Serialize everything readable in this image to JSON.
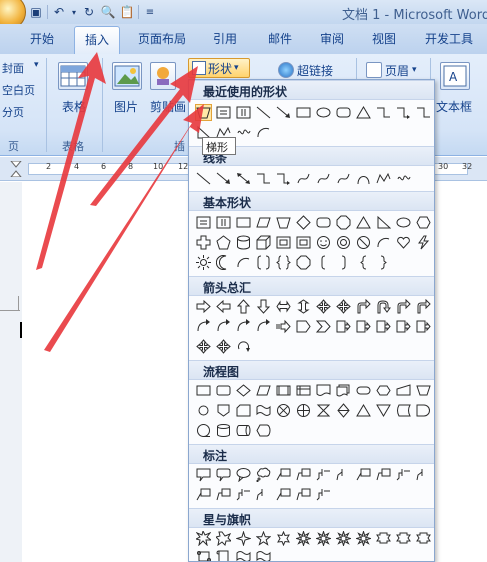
{
  "app": {
    "doc_title": "文档 1 - Microsoft Word",
    "quick_access_icons": [
      "save-icon",
      "undo-icon",
      "redo-icon",
      "print-preview-icon",
      "paste-icon",
      "customize-icon"
    ]
  },
  "ribbon": {
    "tabs": [
      "开始",
      "插入",
      "页面布局",
      "引用",
      "邮件",
      "审阅",
      "视图",
      "开发工具"
    ],
    "active_tab": "插入",
    "left_group": {
      "items": [
        "封面",
        "空白页",
        "分页"
      ],
      "label": "页"
    },
    "table_group": {
      "button": "表格",
      "label": "表格"
    },
    "illustrations": {
      "picture": "图片",
      "clipart": "剪贴画",
      "label": "插"
    },
    "shapes_button": "形状",
    "hyperlink": "超链接",
    "header": "页眉",
    "textbox": "文本框"
  },
  "ruler": {
    "numbers": [
      "2",
      "4",
      "6",
      "8",
      "10",
      "12",
      "30",
      "32"
    ]
  },
  "shapes_panel": {
    "sections": [
      {
        "id": "recent",
        "title": "最近使用的形状"
      },
      {
        "id": "lines",
        "title": "线条"
      },
      {
        "id": "basic",
        "title": "基本形状"
      },
      {
        "id": "arrows",
        "title": "箭头总汇"
      },
      {
        "id": "flowchart",
        "title": "流程图"
      },
      {
        "id": "callouts",
        "title": "标注"
      },
      {
        "id": "stars",
        "title": "星与旗帜"
      }
    ],
    "tooltip": "梯形",
    "selected_shape": "trapezoid"
  },
  "colors": {
    "accent": "#15428b",
    "annotation_arrow": "#e8383d",
    "ribbon_bg": "#d5e4f7",
    "highlight": "#ffd36e"
  }
}
